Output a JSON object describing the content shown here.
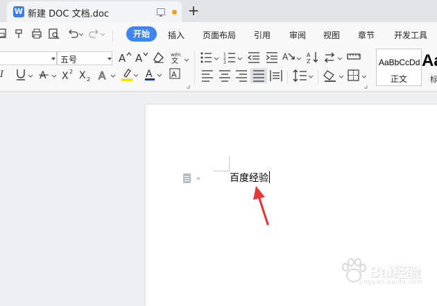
{
  "window": {
    "tab_title": "新建 DOC 文档.doc",
    "app_icon_glyph": "W",
    "new_tab_glyph": "+",
    "unsaved_dot_color": "#f0a01e"
  },
  "quick_access": {
    "icons": [
      "save-icon",
      "format-painter-icon",
      "print-icon",
      "print-preview-icon",
      "undo-icon",
      "redo-icon"
    ]
  },
  "menu": {
    "active": "开始",
    "items": [
      "插入",
      "页面布局",
      "引用",
      "审阅",
      "视图",
      "章节",
      "开发工具"
    ],
    "accent_color": "#3e84f2"
  },
  "ribbon": {
    "font_size_value": "五号",
    "style_sample_text": "AaBbCcDd",
    "style_normal_label": "正文",
    "style_next_sample": "Aa",
    "style_next_label": "标"
  },
  "document": {
    "text": "百度经验"
  },
  "watermark": {
    "brand": "Bai",
    "brand_cn": "经验",
    "url": "jingyan.baidu.com"
  },
  "annotation": {
    "arrow_color": "#e23a3a"
  }
}
